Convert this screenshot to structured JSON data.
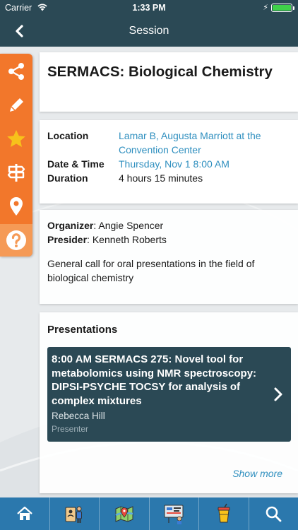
{
  "status": {
    "carrier": "Carrier",
    "time": "1:33 PM",
    "battery_level": 1.0
  },
  "nav": {
    "title": "Session",
    "back_icon": "chevron-left-icon"
  },
  "sidebar": {
    "items": [
      {
        "icon": "share-icon"
      },
      {
        "icon": "pencil-icon"
      },
      {
        "icon": "star-icon"
      },
      {
        "icon": "signpost-icon"
      },
      {
        "icon": "map-pin-icon"
      },
      {
        "icon": "question-icon"
      }
    ],
    "color": "#f2772b"
  },
  "session": {
    "title": "SERMACS: Biological Chemistry",
    "location_label": "Location",
    "location": "Lamar B, Augusta Marriott at the Convention Center",
    "datetime_label": "Date & Time",
    "datetime": "Thursday, Nov 1 8:00 AM",
    "duration_label": "Duration",
    "duration": "4 hours 15 minutes",
    "organizer_label": "Organizer",
    "organizer": "Angie Spencer",
    "presider_label": "Presider",
    "presider": "Kenneth Roberts",
    "description": "General call for oral presentations in the field of biological chemistry"
  },
  "presentations": {
    "heading": "Presentations",
    "items": [
      {
        "title": "8:00 AM  SERMACS 275: Novel tool for metabolomics using NMR spectroscopy: DIPSI-PSYCHE TOCSY for analysis of complex mixtures",
        "presenter": "Rebecca Hill",
        "role": "Presenter"
      }
    ],
    "show_more": "Show more"
  },
  "tabbar": {
    "items": [
      {
        "icon": "home-icon"
      },
      {
        "icon": "badge-person-icon"
      },
      {
        "icon": "map-icon"
      },
      {
        "icon": "poster-icon"
      },
      {
        "icon": "drink-cup-icon"
      },
      {
        "icon": "search-icon"
      }
    ],
    "color": "#2b78ad"
  },
  "colors": {
    "header": "#2b4955",
    "accent": "#f2772b",
    "link": "#2f8fbf"
  }
}
